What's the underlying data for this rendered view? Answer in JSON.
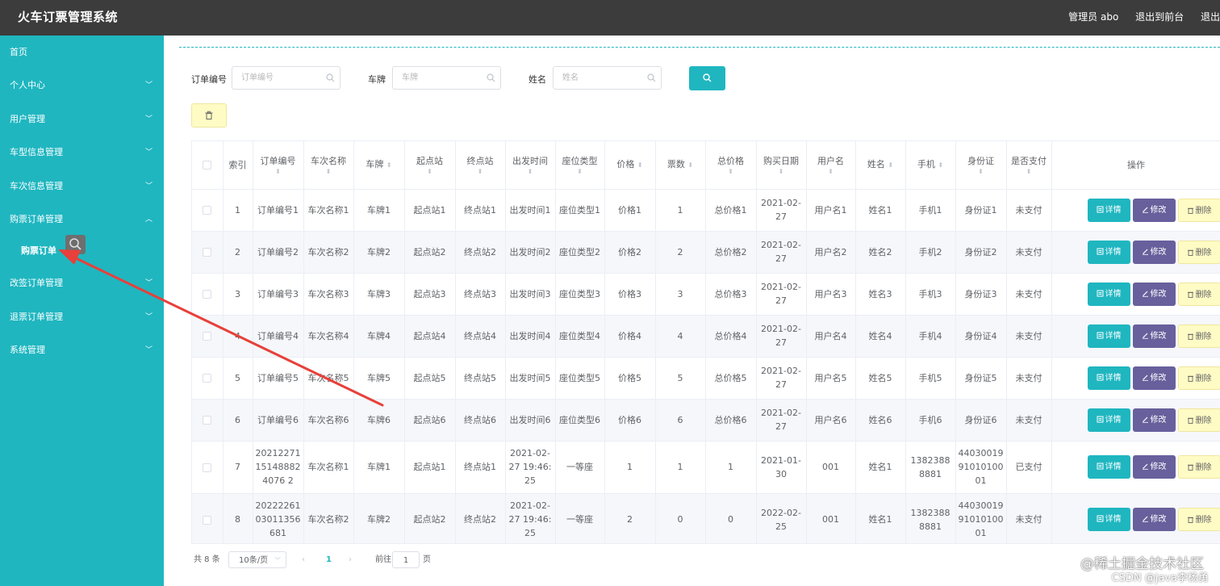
{
  "header": {
    "app_title": "火车订票管理系统",
    "admin": "管理员 abo",
    "to_frontend": "退出到前台",
    "logout": "退出"
  },
  "sidebar": {
    "items": [
      {
        "label": "首页"
      },
      {
        "label": "个人中心"
      },
      {
        "label": "用户管理"
      },
      {
        "label": "车型信息管理"
      },
      {
        "label": "车次信息管理"
      },
      {
        "label": "购票订单管理"
      },
      {
        "label": "改签订单管理"
      },
      {
        "label": "退票订单管理"
      },
      {
        "label": "系统管理"
      }
    ],
    "sub_item": "购票订单"
  },
  "filters": {
    "order_no_label": "订单编号",
    "order_no_placeholder": "订单编号",
    "plate_label": "车牌",
    "plate_placeholder": "车牌",
    "name_label": "姓名",
    "name_placeholder": "姓名"
  },
  "table": {
    "columns": [
      "索引",
      "订单编号",
      "车次名称",
      "车牌",
      "起点站",
      "终点站",
      "出发时间",
      "座位类型",
      "价格",
      "票数",
      "总价格",
      "购买日期",
      "用户名",
      "姓名",
      "手机",
      "身份证",
      "是否支付",
      "操作"
    ],
    "rows": [
      [
        "1",
        "订单编号1",
        "车次名称1",
        "车牌1",
        "起点站1",
        "终点站1",
        "出发时间1",
        "座位类型1",
        "价格1",
        "1",
        "总价格1",
        "2021-02-27",
        "用户名1",
        "姓名1",
        "手机1",
        "身份证1",
        "未支付"
      ],
      [
        "2",
        "订单编号2",
        "车次名称2",
        "车牌2",
        "起点站2",
        "终点站2",
        "出发时间2",
        "座位类型2",
        "价格2",
        "2",
        "总价格2",
        "2021-02-27",
        "用户名2",
        "姓名2",
        "手机2",
        "身份证2",
        "未支付"
      ],
      [
        "3",
        "订单编号3",
        "车次名称3",
        "车牌3",
        "起点站3",
        "终点站3",
        "出发时间3",
        "座位类型3",
        "价格3",
        "3",
        "总价格3",
        "2021-02-27",
        "用户名3",
        "姓名3",
        "手机3",
        "身份证3",
        "未支付"
      ],
      [
        "4",
        "订单编号4",
        "车次名称4",
        "车牌4",
        "起点站4",
        "终点站4",
        "出发时间4",
        "座位类型4",
        "价格4",
        "4",
        "总价格4",
        "2021-02-27",
        "用户名4",
        "姓名4",
        "手机4",
        "身份证4",
        "未支付"
      ],
      [
        "5",
        "订单编号5",
        "车次名称5",
        "车牌5",
        "起点站5",
        "终点站5",
        "出发时间5",
        "座位类型5",
        "价格5",
        "5",
        "总价格5",
        "2021-02-27",
        "用户名5",
        "姓名5",
        "手机5",
        "身份证5",
        "未支付"
      ],
      [
        "6",
        "订单编号6",
        "车次名称6",
        "车牌6",
        "起点站6",
        "终点站6",
        "出发时间6",
        "座位类型6",
        "价格6",
        "6",
        "总价格6",
        "2021-02-27",
        "用户名6",
        "姓名6",
        "手机6",
        "身份证6",
        "未支付"
      ],
      [
        "7",
        "20212271151488824076 2",
        "车次名称1",
        "车牌1",
        "起点站1",
        "终点站1",
        "2021-02-27 19:46:25",
        "一等座",
        "1",
        "1",
        "1",
        "2021-01-30",
        "001",
        "姓名1",
        "13823888881",
        "440300199101010001",
        "已支付"
      ],
      [
        "8",
        "2022226103011356681",
        "车次名称2",
        "车牌2",
        "起点站2",
        "终点站2",
        "2021-02-27 19:46:25",
        "一等座",
        "2",
        "0",
        "0",
        "2022-02-25",
        "001",
        "姓名1",
        "13823888881",
        "440300199101010001",
        "未支付"
      ]
    ],
    "actions": {
      "detail": "详情",
      "edit": "修改",
      "delete": "删除"
    }
  },
  "pagination": {
    "total": "共 8 条",
    "page_size": "10条/页",
    "current_page": "1",
    "goto_label": "前往",
    "goto_value": "1",
    "page_suffix": "页"
  },
  "watermark": {
    "line1": "@稀土掘金技术社区",
    "line2": "CSDN @java李杨勇"
  },
  "colors": {
    "header_bg": "#3c3c3c",
    "sidebar_bg": "#1fb6c0",
    "accent": "#1fb6c0",
    "edit_btn": "#67609c",
    "delete_btn": "#fffbc4",
    "annotation_arrow": "#e8403a"
  }
}
